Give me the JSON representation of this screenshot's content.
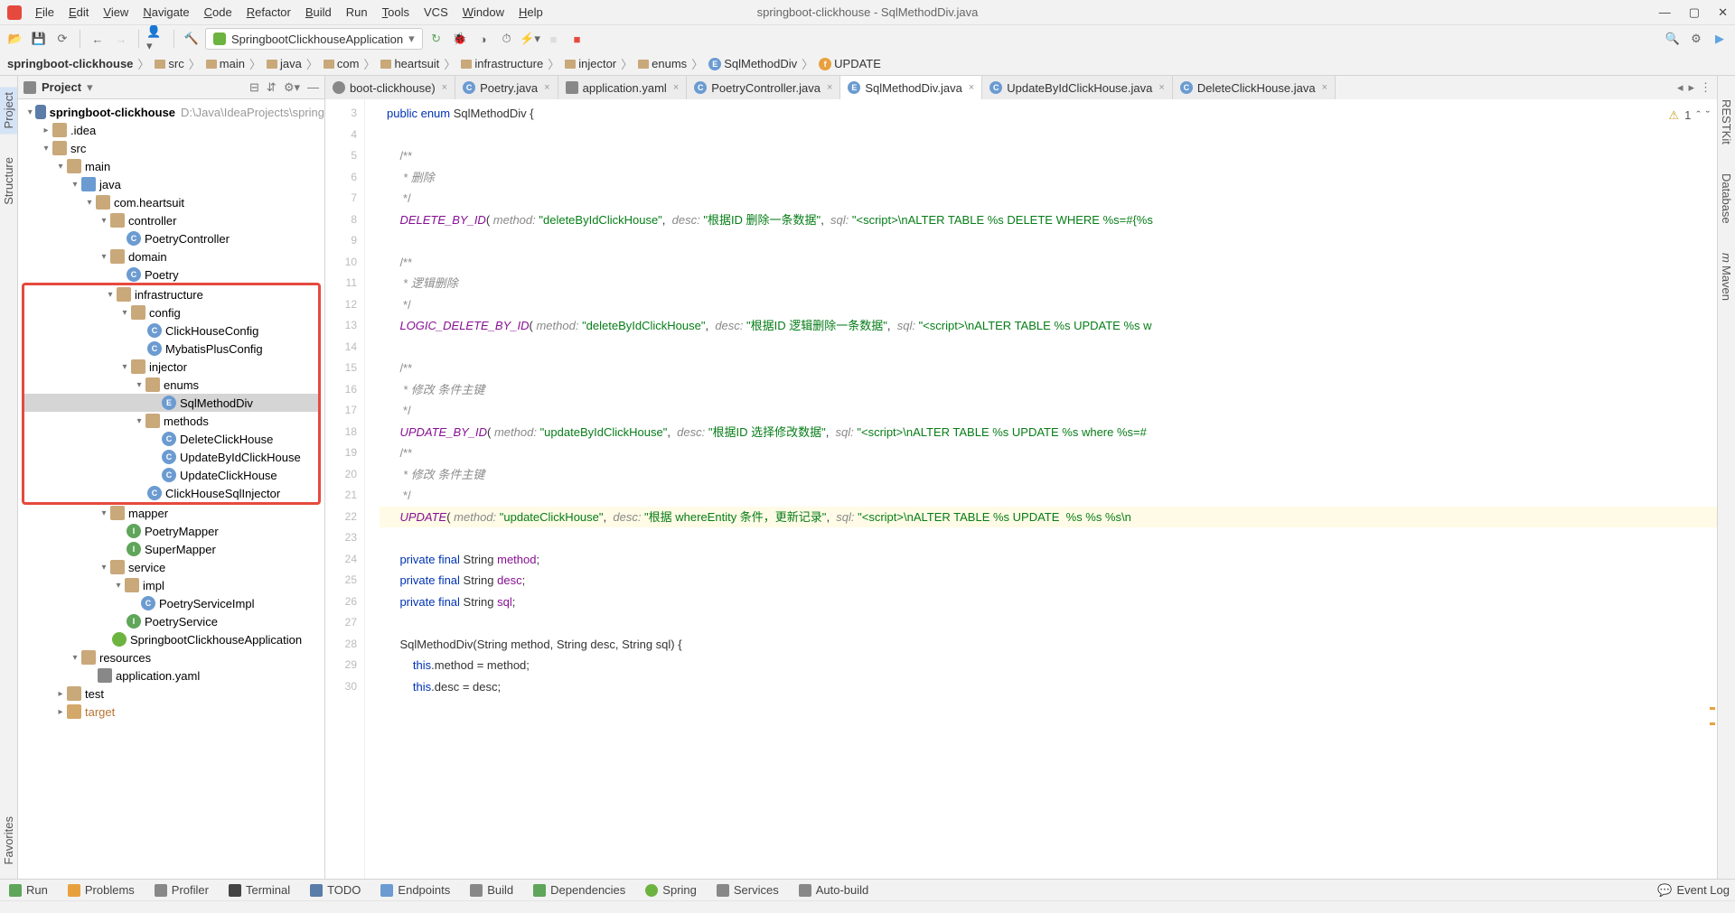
{
  "window": {
    "title": "springboot-clickhouse - SqlMethodDiv.java"
  },
  "menu": [
    "File",
    "Edit",
    "View",
    "Navigate",
    "Code",
    "Refactor",
    "Build",
    "Run",
    "Tools",
    "VCS",
    "Window",
    "Help"
  ],
  "runConfig": "SpringbootClickhouseApplication",
  "breadcrumb": [
    {
      "text": "springboot-clickhouse",
      "icon": "none"
    },
    {
      "text": "src",
      "icon": "folder"
    },
    {
      "text": "main",
      "icon": "folder"
    },
    {
      "text": "java",
      "icon": "folder"
    },
    {
      "text": "com",
      "icon": "folder"
    },
    {
      "text": "heartsuit",
      "icon": "folder"
    },
    {
      "text": "infrastructure",
      "icon": "folder"
    },
    {
      "text": "injector",
      "icon": "folder"
    },
    {
      "text": "enums",
      "icon": "folder"
    },
    {
      "text": "SqlMethodDiv",
      "icon": "enum"
    },
    {
      "text": "UPDATE",
      "icon": "field"
    }
  ],
  "projectPanel": {
    "title": "Project"
  },
  "tree": {
    "root": {
      "text": "springboot-clickhouse",
      "path": "D:\\Java\\IdeaProjects\\spring"
    },
    "idea": ".idea",
    "src": "src",
    "main": "main",
    "java": "java",
    "pkg": "com.heartsuit",
    "controller": "controller",
    "poetryController": "PoetryController",
    "domain": "domain",
    "poetry": "Poetry",
    "infrastructure": "infrastructure",
    "config": "config",
    "clickHouseConfig": "ClickHouseConfig",
    "mybatisPlusConfig": "MybatisPlusConfig",
    "injector": "injector",
    "enums": "enums",
    "sqlMethodDiv": "SqlMethodDiv",
    "methods": "methods",
    "deleteClickHouse": "DeleteClickHouse",
    "updateByIdClickHouse": "UpdateByIdClickHouse",
    "updateClickHouse": "UpdateClickHouse",
    "clickHouseSqlInjector": "ClickHouseSqlInjector",
    "mapper": "mapper",
    "poetryMapper": "PoetryMapper",
    "superMapper": "SuperMapper",
    "service": "service",
    "impl": "impl",
    "poetryServiceImpl": "PoetryServiceImpl",
    "poetryService": "PoetryService",
    "springApp": "SpringbootClickhouseApplication",
    "resources": "resources",
    "appYaml": "application.yaml",
    "test": "test",
    "target": "target"
  },
  "tabs": [
    {
      "label": "boot-clickhouse)",
      "color": "#888",
      "active": false,
      "letter": ""
    },
    {
      "label": "Poetry.java",
      "color": "#6b9bd1",
      "active": false,
      "letter": "C"
    },
    {
      "label": "application.yaml",
      "color": "#888",
      "active": false,
      "letter": ""
    },
    {
      "label": "PoetryController.java",
      "color": "#6b9bd1",
      "active": false,
      "letter": "C"
    },
    {
      "label": "SqlMethodDiv.java",
      "color": "#6b9bd1",
      "active": true,
      "letter": "E"
    },
    {
      "label": "UpdateByIdClickHouse.java",
      "color": "#6b9bd1",
      "active": false,
      "letter": "C"
    },
    {
      "label": "DeleteClickHouse.java",
      "color": "#6b9bd1",
      "active": false,
      "letter": "C"
    }
  ],
  "inspection": {
    "warnings": "1"
  },
  "code": {
    "lines": [
      3,
      4,
      5,
      6,
      7,
      8,
      9,
      10,
      11,
      12,
      13,
      14,
      15,
      16,
      17,
      18,
      19,
      20,
      21,
      22,
      23,
      24,
      25,
      26,
      27,
      28,
      29,
      30
    ],
    "l3_kw1": "public",
    "l3_kw2": "enum",
    "l3_name": "SqlMethodDiv",
    "l3_brace": " {",
    "l5": "    /**",
    "l6": "     * 删除",
    "l7": "     */",
    "l8_const": "    DELETE_BY_ID",
    "l8_open": "( ",
    "l8_p1": "method:",
    "l8_s1": " \"deleteByIdClickHouse\"",
    "l8_c1": ",  ",
    "l8_p2": "desc:",
    "l8_s2": " \"根据ID 删除一条数据\"",
    "l8_c2": ",  ",
    "l8_p3": "sql:",
    "l8_s3": " \"<script>\\nALTER TABLE %s DELETE WHERE %s=#{%s",
    "l10": "    /**",
    "l11": "     * 逻辑删除",
    "l12": "     */",
    "l13_const": "    LOGIC_DELETE_BY_ID",
    "l13_open": "( ",
    "l13_p1": "method:",
    "l13_s1": " \"deleteByIdClickHouse\"",
    "l13_c1": ",  ",
    "l13_p2": "desc:",
    "l13_s2": " \"根据ID 逻辑删除一条数据\"",
    "l13_c2": ",  ",
    "l13_p3": "sql:",
    "l13_s3": " \"<script>\\nALTER TABLE %s UPDATE %s w",
    "l15": "    /**",
    "l16": "     * 修改 条件主键",
    "l17": "     */",
    "l18_const": "    UPDATE_BY_ID",
    "l18_open": "( ",
    "l18_p1": "method:",
    "l18_s1": " \"updateByIdClickHouse\"",
    "l18_c1": ",  ",
    "l18_p2": "desc:",
    "l18_s2": " \"根据ID 选择修改数据\"",
    "l18_c2": ",  ",
    "l18_p3": "sql:",
    "l18_s3": " \"<script>\\nALTER TABLE %s UPDATE %s where %s=#",
    "l19": "    /**",
    "l20": "     * 修改 条件主键",
    "l21": "     */",
    "l22_const": "    UPDATE",
    "l22_open": "( ",
    "l22_p1": "method:",
    "l22_s1": " \"updateClickHouse\"",
    "l22_c1": ",  ",
    "l22_p2": "desc:",
    "l22_s2": " \"根据 whereEntity 条件，更新记录\"",
    "l22_c2": ",  ",
    "l22_p3": "sql:",
    "l22_s3": " \"<script>\\nALTER TABLE %s UPDATE  %s %s %s\\n",
    "l24_kw": "    private final ",
    "l24_t": "String ",
    "l24_f": "method",
    "l24_e": ";",
    "l25_kw": "    private final ",
    "l25_t": "String ",
    "l25_f": "desc",
    "l25_e": ";",
    "l26_kw": "    private final ",
    "l26_t": "String ",
    "l26_f": "sql",
    "l26_e": ";",
    "l28": "    SqlMethodDiv(String method, String desc, String sql) {",
    "l29_prefix": "        ",
    "l29_kw": "this",
    "l29_rest": ".method = method;",
    "l30_prefix": "        ",
    "l30_kw": "this",
    "l30_rest": ".desc = desc;"
  },
  "leftTabs": [
    "Project",
    "Structure",
    "Favorites"
  ],
  "rightTabs": [
    "RESTKit",
    "Database",
    "Maven"
  ],
  "bottomTabs": [
    "Run",
    "Problems",
    "Profiler",
    "Terminal",
    "TODO",
    "Endpoints",
    "Build",
    "Dependencies",
    "Spring",
    "Services",
    "Auto-build"
  ],
  "eventLog": "Event Log"
}
